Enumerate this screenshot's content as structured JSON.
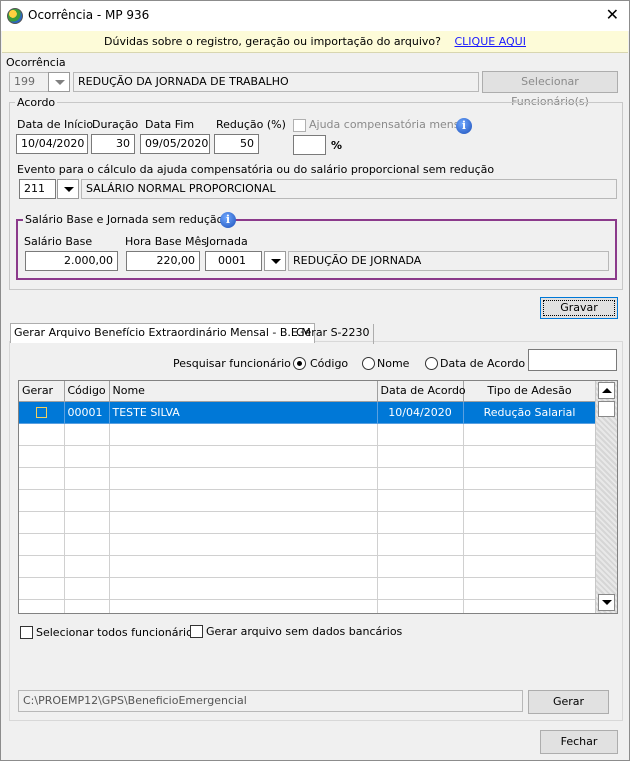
{
  "window": {
    "title": "Ocorrência - MP 936",
    "close_icon": "close-icon",
    "app_icon": "app-globe-icon"
  },
  "help_bar": {
    "text": "Dúvidas sobre o registro, geração ou importação do arquivo?",
    "link": "CLIQUE AQUI",
    "link_color": "#1a1aff"
  },
  "ocorrencia": {
    "label": "Ocorrência",
    "code": "199",
    "description": "REDUÇÃO DA JORNADA DE TRABALHO",
    "select_button": "Selecionar Funcionário(s)"
  },
  "acordo": {
    "group_title": "Acordo",
    "data_inicio_label": "Data de Início",
    "data_inicio": "10/04/2020",
    "duracao_label": "Duração",
    "duracao": "30",
    "data_fim_label": "Data Fim",
    "data_fim": "09/05/2020",
    "reducao_label": "Redução (%)",
    "reducao": "50",
    "ajuda_label": "Ajuda compensatória mensal",
    "ajuda_unit": "%",
    "evento_label": "Evento para o cálculo da ajuda compensatória ou do salário proporcional sem redução",
    "evento_code": "211",
    "evento_desc": "SALÁRIO NORMAL PROPORCIONAL"
  },
  "salario": {
    "group_title": "Salário Base e Jornada sem redução",
    "salario_base_label": "Salário Base",
    "salario_base": "2.000,00",
    "hora_base_label": "Hora Base Mês",
    "hora_base": "220,00",
    "jornada_label": "Jornada",
    "jornada_code": "0001",
    "jornada_desc": "REDUÇÃO DE JORNADA",
    "border_color": "#8b3a8b"
  },
  "gravar_button": "Gravar",
  "tabs": [
    {
      "label": "Gerar Arquivo Benefício Extraordinário Mensal - B.E.M",
      "active": true
    },
    {
      "label": "Gerar S-2230",
      "active": false
    }
  ],
  "search": {
    "label": "Pesquisar funcionário",
    "options": [
      "Código",
      "Nome",
      "Data de Acordo"
    ],
    "selected": "Código",
    "value": ""
  },
  "grid": {
    "columns": [
      "Gerar",
      "Código",
      "Nome",
      "Data de Acordo",
      "Tipo de Adesão"
    ],
    "rows": [
      {
        "gerar": false,
        "codigo": "00001",
        "nome": "TESTE SILVA",
        "data_acordo": "10/04/2020",
        "tipo_adesao": "Redução Salarial",
        "selected": true
      }
    ],
    "empty_rows": 9,
    "selection_color": "#0078d7"
  },
  "options": {
    "select_all": "Selecionar todos funcionários",
    "no_bank": "Gerar arquivo sem dados bancários"
  },
  "output": {
    "path": "C:\\PROEMP12\\GPS\\BeneficioEmergencial",
    "generate_button": "Gerar"
  },
  "fechar_button": "Fechar"
}
